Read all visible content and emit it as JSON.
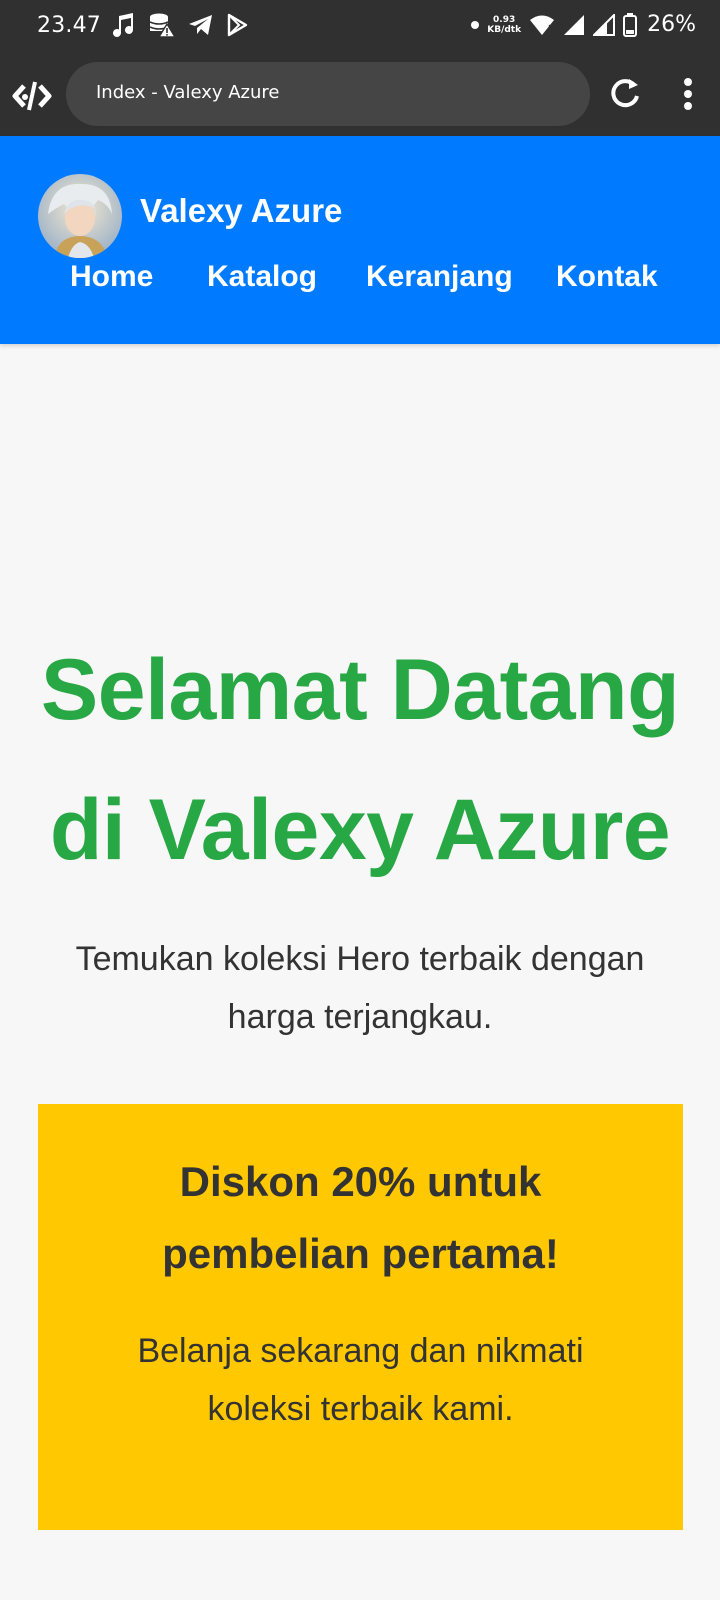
{
  "status_bar": {
    "time": "23.47",
    "net_speed_value": "0.93",
    "net_speed_unit": "KB/dtk",
    "battery": "26%"
  },
  "browser": {
    "tab_title": "Index - Valexy Azure"
  },
  "site": {
    "title": "Valexy Azure",
    "nav": [
      "Home",
      "Katalog",
      "Keranjang",
      "Kontak"
    ]
  },
  "hero": {
    "title_line1": "Selamat Datang",
    "title_line2": "di Valexy Azure",
    "subtitle_line1": "Temukan koleksi Hero terbaik dengan",
    "subtitle_line2": "harga terjangkau."
  },
  "promo": {
    "title_line1": "Diskon 20% untuk",
    "title_line2": "pembelian pertama!",
    "text_line1": "Belanja sekarang dan nikmati",
    "text_line2": "koleksi terbaik kami."
  },
  "colors": {
    "header_bg": "#007bff",
    "hero_title": "#28a745",
    "promo_bg": "#ffc800",
    "page_bg": "#f7f7f7",
    "browser_bg": "#303030"
  },
  "icons": {
    "status_left": [
      "music-note-icon",
      "database-warning-icon",
      "telegram-icon",
      "play-store-icon"
    ],
    "status_right": [
      "notification-dot-icon",
      "wifi-icon",
      "signal-icon",
      "signal-weak-icon",
      "battery-icon"
    ],
    "browser": [
      "browser-logo-icon",
      "reload-icon",
      "overflow-menu-icon"
    ]
  }
}
